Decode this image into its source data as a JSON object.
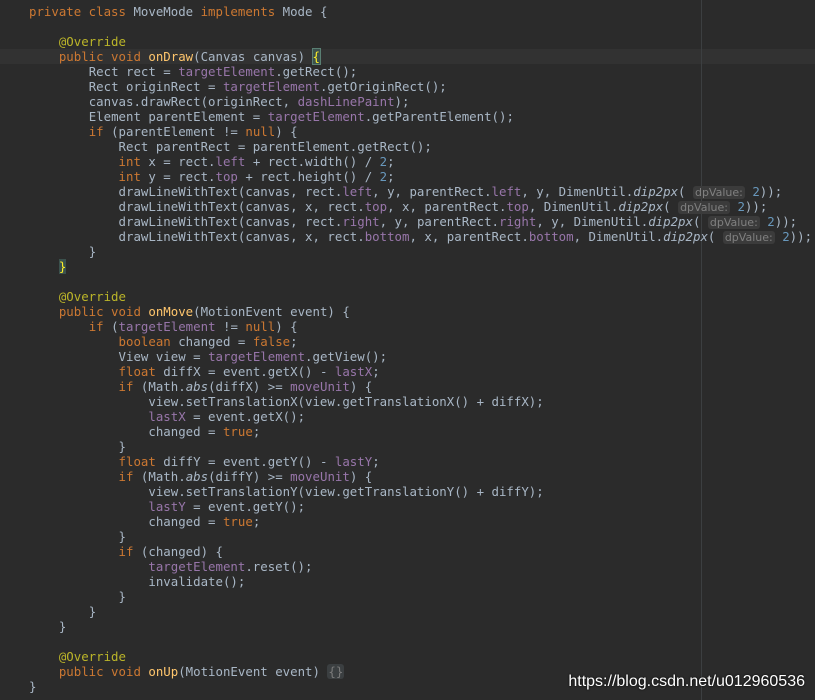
{
  "lines": [
    [
      [
        "kw",
        "private class "
      ],
      [
        "tx",
        "MoveMode "
      ],
      [
        "kw",
        "implements "
      ],
      [
        "tx",
        "Mode {"
      ]
    ],
    [],
    [
      [
        "ann",
        "@Override"
      ]
    ],
    [
      [
        "kw",
        "public void "
      ],
      [
        "fn",
        "onDraw"
      ],
      [
        "tx",
        "(Canvas canvas) "
      ],
      [
        "bh",
        "{"
      ]
    ],
    [
      [
        "tx",
        "Rect rect = "
      ],
      [
        "fld",
        "targetElement"
      ],
      [
        "tx",
        ".getRect();"
      ]
    ],
    [
      [
        "tx",
        "Rect originRect = "
      ],
      [
        "fld",
        "targetElement"
      ],
      [
        "tx",
        ".getOriginRect();"
      ]
    ],
    [
      [
        "tx",
        "canvas.drawRect(originRect, "
      ],
      [
        "fld",
        "dashLinePaint"
      ],
      [
        "tx",
        ");"
      ]
    ],
    [
      [
        "tx",
        "Element parentElement = "
      ],
      [
        "fld",
        "targetElement"
      ],
      [
        "tx",
        ".getParentElement();"
      ]
    ],
    [
      [
        "kw",
        "if "
      ],
      [
        "tx",
        "(parentElement != "
      ],
      [
        "kw",
        "null"
      ],
      [
        "tx",
        ") {"
      ]
    ],
    [
      [
        "tx",
        "Rect parentRect = parentElement.getRect();"
      ]
    ],
    [
      [
        "kw",
        "int "
      ],
      [
        "tx",
        "x = rect."
      ],
      [
        "fld",
        "left"
      ],
      [
        "tx",
        " + rect.width() / "
      ],
      [
        "num",
        "2"
      ],
      [
        "tx",
        ";"
      ]
    ],
    [
      [
        "kw",
        "int "
      ],
      [
        "tx",
        "y = rect."
      ],
      [
        "fld",
        "top"
      ],
      [
        "tx",
        " + rect.height() / "
      ],
      [
        "num",
        "2"
      ],
      [
        "tx",
        ";"
      ]
    ],
    [
      [
        "tx",
        "drawLineWithText(canvas, rect."
      ],
      [
        "fld",
        "left"
      ],
      [
        "tx",
        ", y, parentRect."
      ],
      [
        "fld",
        "left"
      ],
      [
        "tx",
        ", y, DimenUtil."
      ],
      [
        "it",
        "dip2px"
      ],
      [
        "tx",
        "( "
      ],
      [
        "hint",
        "dpValue:"
      ],
      [
        "tx",
        " "
      ],
      [
        "num",
        "2"
      ],
      [
        "tx",
        "));"
      ]
    ],
    [
      [
        "tx",
        "drawLineWithText(canvas, x, rect."
      ],
      [
        "fld",
        "top"
      ],
      [
        "tx",
        ", x, parentRect."
      ],
      [
        "fld",
        "top"
      ],
      [
        "tx",
        ", DimenUtil."
      ],
      [
        "it",
        "dip2px"
      ],
      [
        "tx",
        "( "
      ],
      [
        "hint",
        "dpValue:"
      ],
      [
        "tx",
        " "
      ],
      [
        "num",
        "2"
      ],
      [
        "tx",
        "));"
      ]
    ],
    [
      [
        "tx",
        "drawLineWithText(canvas, rect."
      ],
      [
        "fld",
        "right"
      ],
      [
        "tx",
        ", y, parentRect."
      ],
      [
        "fld",
        "right"
      ],
      [
        "tx",
        ", y, DimenUtil."
      ],
      [
        "it",
        "dip2px"
      ],
      [
        "tx",
        "( "
      ],
      [
        "hint",
        "dpValue:"
      ],
      [
        "tx",
        " "
      ],
      [
        "num",
        "2"
      ],
      [
        "tx",
        "));"
      ]
    ],
    [
      [
        "tx",
        "drawLineWithText(canvas, x, rect."
      ],
      [
        "fld",
        "bottom"
      ],
      [
        "tx",
        ", x, parentRect."
      ],
      [
        "fld",
        "bottom"
      ],
      [
        "tx",
        ", DimenUtil."
      ],
      [
        "it",
        "dip2px"
      ],
      [
        "tx",
        "( "
      ],
      [
        "hint",
        "dpValue:"
      ],
      [
        "tx",
        " "
      ],
      [
        "num",
        "2"
      ],
      [
        "tx",
        "));"
      ]
    ],
    [
      [
        "tx",
        "}"
      ]
    ],
    [
      [
        "bh2",
        "}"
      ]
    ],
    [],
    [
      [
        "ann",
        "@Override"
      ]
    ],
    [
      [
        "kw",
        "public void "
      ],
      [
        "fn",
        "onMove"
      ],
      [
        "tx",
        "(MotionEvent event) {"
      ]
    ],
    [
      [
        "kw",
        "if "
      ],
      [
        "tx",
        "("
      ],
      [
        "fld",
        "targetElement"
      ],
      [
        "tx",
        " != "
      ],
      [
        "kw",
        "null"
      ],
      [
        "tx",
        ") {"
      ]
    ],
    [
      [
        "kw",
        "boolean "
      ],
      [
        "tx",
        "changed = "
      ],
      [
        "kw",
        "false"
      ],
      [
        "tx",
        ";"
      ]
    ],
    [
      [
        "tx",
        "View view = "
      ],
      [
        "fld",
        "targetElement"
      ],
      [
        "tx",
        ".getView();"
      ]
    ],
    [
      [
        "kw",
        "float "
      ],
      [
        "tx",
        "diffX = event.getX() - "
      ],
      [
        "fld",
        "lastX"
      ],
      [
        "tx",
        ";"
      ]
    ],
    [
      [
        "kw",
        "if "
      ],
      [
        "tx",
        "(Math."
      ],
      [
        "it",
        "abs"
      ],
      [
        "tx",
        "(diffX) >= "
      ],
      [
        "fld",
        "moveUnit"
      ],
      [
        "tx",
        ") {"
      ]
    ],
    [
      [
        "tx",
        "view.setTranslationX(view.getTranslationX() + diffX);"
      ]
    ],
    [
      [
        "fld",
        "lastX"
      ],
      [
        "tx",
        " = event.getX();"
      ]
    ],
    [
      [
        "tx",
        "changed = "
      ],
      [
        "kw",
        "true"
      ],
      [
        "tx",
        ";"
      ]
    ],
    [
      [
        "tx",
        "}"
      ]
    ],
    [
      [
        "kw",
        "float "
      ],
      [
        "tx",
        "diffY = event.getY() - "
      ],
      [
        "fld",
        "lastY"
      ],
      [
        "tx",
        ";"
      ]
    ],
    [
      [
        "kw",
        "if "
      ],
      [
        "tx",
        "(Math."
      ],
      [
        "it",
        "abs"
      ],
      [
        "tx",
        "(diffY) >= "
      ],
      [
        "fld",
        "moveUnit"
      ],
      [
        "tx",
        ") {"
      ]
    ],
    [
      [
        "tx",
        "view.setTranslationY(view.getTranslationY() + diffY);"
      ]
    ],
    [
      [
        "fld",
        "lastY"
      ],
      [
        "tx",
        " = event.getY();"
      ]
    ],
    [
      [
        "tx",
        "changed = "
      ],
      [
        "kw",
        "true"
      ],
      [
        "tx",
        ";"
      ]
    ],
    [
      [
        "tx",
        "}"
      ]
    ],
    [
      [
        "kw",
        "if "
      ],
      [
        "tx",
        "(changed) {"
      ]
    ],
    [
      [
        "fld",
        "targetElement"
      ],
      [
        "tx",
        ".reset();"
      ]
    ],
    [
      [
        "tx",
        "invalidate();"
      ]
    ],
    [
      [
        "tx",
        "}"
      ]
    ],
    [
      [
        "tx",
        "}"
      ]
    ],
    [
      [
        "tx",
        "}"
      ]
    ],
    [],
    [
      [
        "ann",
        "@Override"
      ]
    ],
    [
      [
        "kw",
        "public void "
      ],
      [
        "fn",
        "onUp"
      ],
      [
        "tx",
        "(MotionEvent event) "
      ],
      [
        "fold",
        "{}"
      ]
    ],
    [
      [
        "tx",
        "}"
      ]
    ]
  ],
  "indents": [
    0,
    0,
    1,
    1,
    2,
    2,
    2,
    2,
    2,
    3,
    3,
    3,
    3,
    3,
    3,
    3,
    2,
    1,
    0,
    1,
    1,
    2,
    3,
    3,
    3,
    3,
    4,
    4,
    4,
    3,
    3,
    3,
    4,
    4,
    4,
    3,
    3,
    4,
    4,
    3,
    2,
    1,
    0,
    1,
    1,
    0
  ],
  "watermark": "https://blog.csdn.net/u012960536",
  "colors": {
    "background": "#2b2b2b",
    "keyword": "#cc7832",
    "annotation": "#bbb529",
    "method": "#ffc66d",
    "field": "#9876aa",
    "number": "#6897bb",
    "text": "#a9b7c6"
  }
}
